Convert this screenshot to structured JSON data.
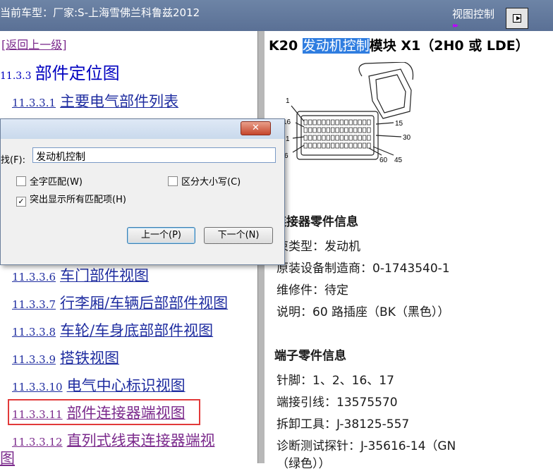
{
  "topbar": {
    "title": "当前车型：厂家:S-上海雪佛兰科鲁兹2012",
    "view_control": "视图控制"
  },
  "left": {
    "back_link": "[返回上一级]",
    "section": {
      "number": "11.3.3",
      "title": "部件定位图"
    },
    "items": [
      {
        "number": "11.3.3.1",
        "title": "主要电气部件列表"
      },
      {
        "number": "11.3.3.6",
        "title": "车门部件视图"
      },
      {
        "number": "11.3.3.7",
        "title": "行李厢/车辆后部部件视图"
      },
      {
        "number": "11.3.3.8",
        "title": "车轮/车身底部部件视图"
      },
      {
        "number": "11.3.3.9",
        "title": "搭铁视图"
      },
      {
        "number": "11.3.3.10",
        "title": "电气中心标识视图"
      },
      {
        "number": "11.3.3.11",
        "title": "部件连接器端视图"
      },
      {
        "number": "11.3.3.12",
        "title": "直列式线束连接器端视"
      }
    ],
    "last_line": "图"
  },
  "find_dialog": {
    "find_label": "找(F):",
    "query": "发动机控制",
    "whole_word": "全字匹配(W)",
    "match_case": "区分大小写(C)",
    "highlight_all": "突出显示所有匹配项(H)",
    "prev_button": "上一个(P)",
    "next_button": "下一个(N)",
    "close_glyph": "✕"
  },
  "right": {
    "title_prefix": "K20 ",
    "title_highlight": "发动机控制",
    "title_suffix": "模块 X1（2H0 或 LDE）",
    "pin_labels": [
      "1",
      "16",
      "1",
      "6",
      "15",
      "30",
      "60",
      "45"
    ],
    "connector_heading": "连接器零件信息",
    "harness_type": "束类型：发动机",
    "oem": "原装设备制造商：0-1743540-1",
    "service": "维修件：待定",
    "description": "说明：60 路插座（BK（黑色））",
    "terminal_heading": "端子零件信息",
    "pins": "针脚：1、2、16、17",
    "terminal": "端接引线：13575570",
    "release_tool": "拆卸工具：J-38125-557",
    "probe": "诊断测试探针：J-35616-14（GN",
    "probe_cont": "（绿色））"
  },
  "colors": {
    "link": "#1f2da0",
    "visited_link": "#7b2a8c",
    "search_highlight": "#2f7de0",
    "annotation_box": "#e23a3a"
  }
}
